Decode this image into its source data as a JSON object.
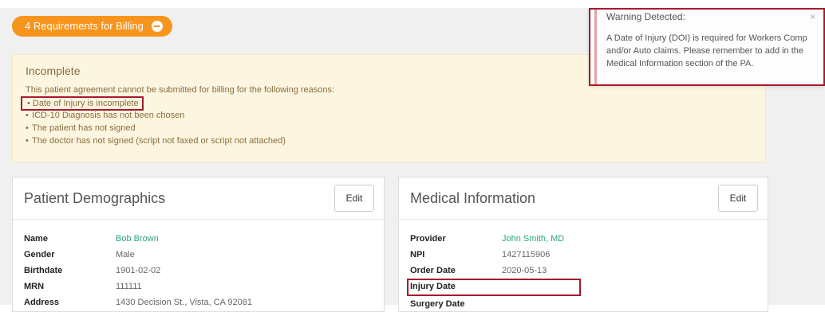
{
  "requirements": {
    "label": "4 Requirements for Billing",
    "toggle_icon": "minus-circle-icon"
  },
  "incomplete": {
    "title": "Incomplete",
    "description": "This patient agreement cannot be submitted for billing for the following reasons:",
    "reasons": [
      "Date of Injury is incomplete",
      "ICD-10 Diagnosis has not been chosen",
      "The patient has not signed",
      "The doctor has not signed (script not faxed or script not attached)"
    ]
  },
  "patient": {
    "title": "Patient Demographics",
    "edit_label": "Edit",
    "rows": [
      {
        "label": "Name",
        "value": "Bob Brown"
      },
      {
        "label": "Gender",
        "value": "Male"
      },
      {
        "label": "Birthdate",
        "value": "1901-02-02"
      },
      {
        "label": "MRN",
        "value": "111111"
      },
      {
        "label": "Address",
        "value": "1430 Decision St., Vista, CA 92081"
      }
    ]
  },
  "medical": {
    "title": "Medical Information",
    "edit_label": "Edit",
    "rows": [
      {
        "label": "Provider",
        "value": "John Smith, MD"
      },
      {
        "label": "NPI",
        "value": "1427115906"
      },
      {
        "label": "Order Date",
        "value": "2020-05-13"
      },
      {
        "label": "Injury Date",
        "value": ""
      },
      {
        "label": "Surgery Date",
        "value": ""
      }
    ]
  },
  "toast": {
    "title": "Warning Detected:",
    "close": "×",
    "message": "A Date of Injury (DOI) is required for Workers Comp and/or Auto claims. Please remember to add in the Medical Information section of the PA."
  },
  "colors": {
    "accent": "#f7941d",
    "link": "#2aa57d",
    "warning_bg": "#fcf6e1",
    "highlight": "#a6192e"
  }
}
